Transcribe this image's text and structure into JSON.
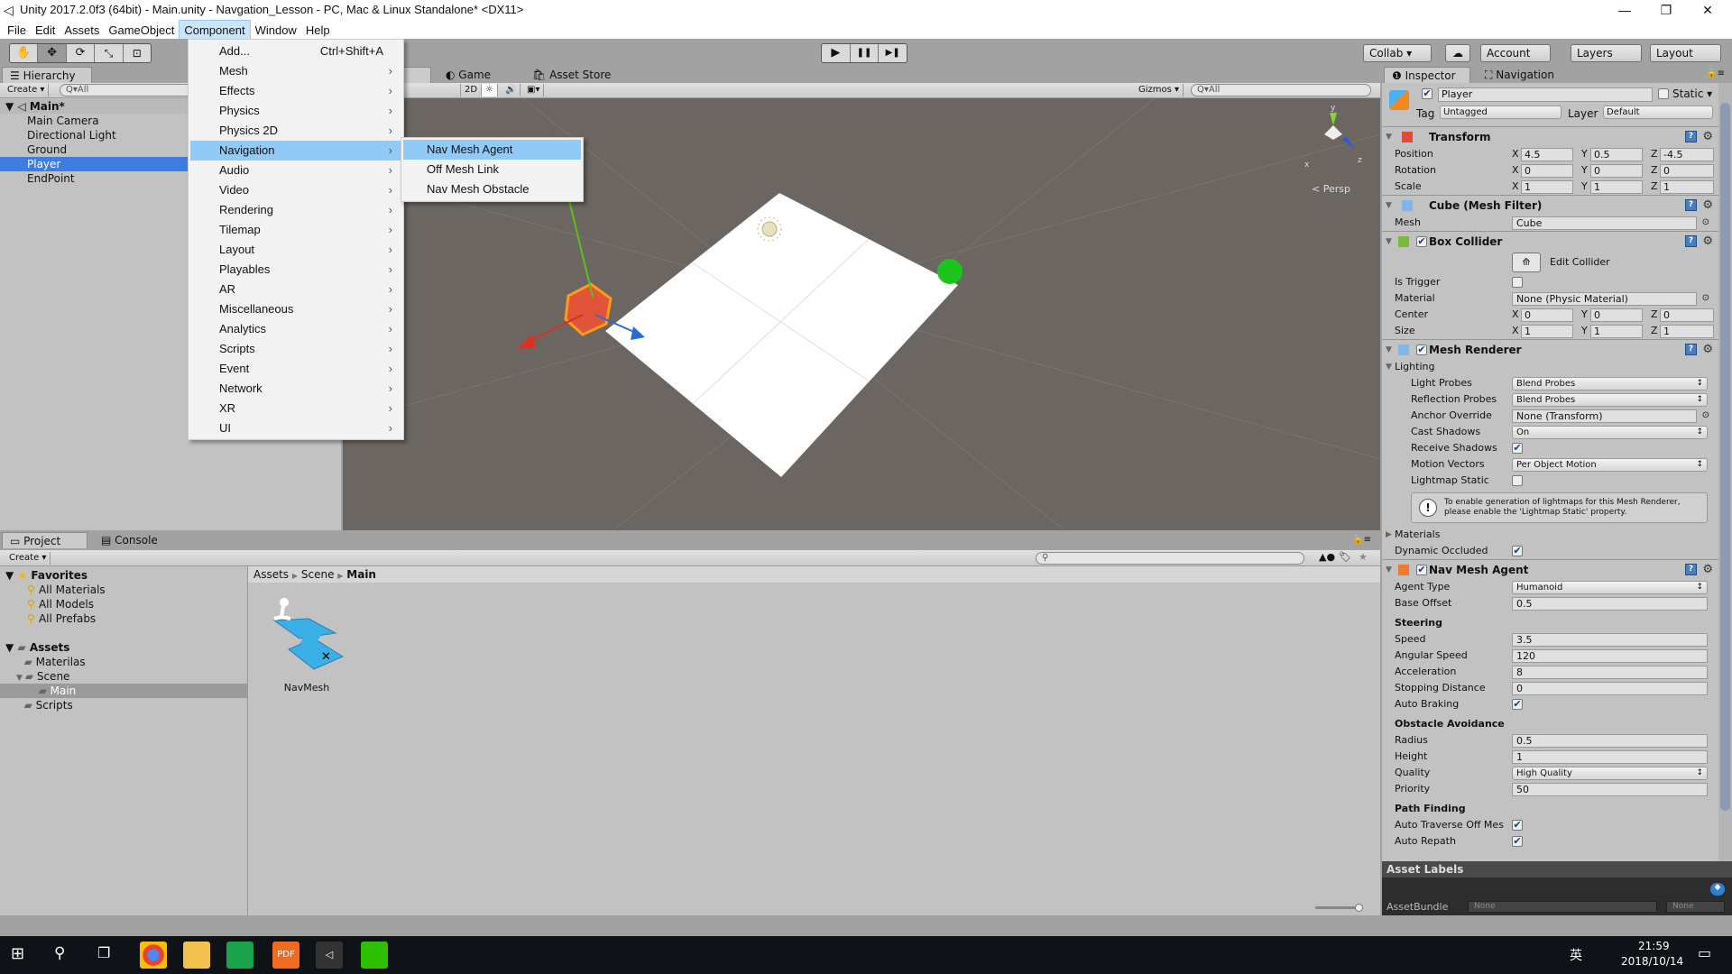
{
  "window": {
    "title": "Unity 2017.2.0f3 (64bit) - Main.unity - Navgation_Lesson - PC, Mac & Linux Standalone* <DX11>",
    "minimize": "—",
    "maximize": "❐",
    "close": "✕"
  },
  "menubar": [
    "File",
    "Edit",
    "Assets",
    "GameObject",
    "Component",
    "Window",
    "Help"
  ],
  "toolbar": {
    "tools": [
      "hand-tool",
      "move-tool",
      "rotate-tool",
      "scale-tool",
      "rect-tool"
    ],
    "play": "▶",
    "pause": "❚❚",
    "step": "▶❚",
    "collab": "Collab ▾",
    "cloud": "☁",
    "account": "Account",
    "layers": "Layers",
    "layout": "Layout"
  },
  "component_menu": {
    "items": [
      {
        "label": "Add...",
        "shortcut": "Ctrl+Shift+A"
      },
      {
        "label": "Mesh"
      },
      {
        "label": "Effects"
      },
      {
        "label": "Physics"
      },
      {
        "label": "Physics 2D"
      },
      {
        "label": "Navigation",
        "highlighted": true
      },
      {
        "label": "Audio"
      },
      {
        "label": "Video"
      },
      {
        "label": "Rendering"
      },
      {
        "label": "Tilemap"
      },
      {
        "label": "Layout"
      },
      {
        "label": "Playables"
      },
      {
        "label": "AR"
      },
      {
        "label": "Miscellaneous"
      },
      {
        "label": "Analytics"
      },
      {
        "label": "Scripts"
      },
      {
        "label": "Event"
      },
      {
        "label": "Network"
      },
      {
        "label": "XR"
      },
      {
        "label": "UI"
      }
    ],
    "submenu": [
      {
        "label": "Nav Mesh Agent",
        "highlighted": true
      },
      {
        "label": "Off Mesh Link"
      },
      {
        "label": "Nav Mesh Obstacle"
      }
    ]
  },
  "hierarchy": {
    "tab": "Hierarchy",
    "create": "Create ▾",
    "search": "Q▾All",
    "scene": "Main*",
    "items": [
      {
        "label": "Main Camera"
      },
      {
        "label": "Directional Light"
      },
      {
        "label": "Ground"
      },
      {
        "label": "Player",
        "selected": true
      },
      {
        "label": "EndPoint"
      }
    ]
  },
  "scene_view": {
    "tabs": [
      "Game",
      "Asset Store"
    ],
    "toggle_2d": "2D",
    "gizmos": "Gizmos ▾",
    "search": "Q▾All",
    "persp": "< Persp",
    "axis_x": "x",
    "axis_y": "y",
    "axis_z": "z"
  },
  "inspector": {
    "tabs": [
      "Inspector",
      "Navigation"
    ],
    "object": {
      "name": "Player",
      "active": true,
      "static_label": "Static",
      "tag_label": "Tag",
      "tag": "Untagged",
      "layer_label": "Layer",
      "layer": "Default"
    },
    "rows": [
      {
        "type": "comp",
        "title": "Transform",
        "icon": "transform"
      },
      {
        "type": "vec",
        "label": "Position",
        "x": "4.5",
        "y": "0.5",
        "z": "-4.5"
      },
      {
        "type": "vec",
        "label": "Rotation",
        "x": "0",
        "y": "0",
        "z": "0"
      },
      {
        "type": "vec",
        "label": "Scale",
        "x": "1",
        "y": "1",
        "z": "1"
      },
      {
        "type": "comp",
        "title": "Cube (Mesh Filter)",
        "icon": "mesh-filter"
      },
      {
        "type": "obj",
        "label": "Mesh",
        "value": "Cube"
      },
      {
        "type": "comp",
        "title": "Box Collider",
        "icon": "box-collider",
        "enabled": true
      },
      {
        "type": "button",
        "label": "Edit Collider"
      },
      {
        "type": "check",
        "label": "Is Trigger",
        "checked": false
      },
      {
        "type": "obj",
        "label": "Material",
        "value": "None (Physic Material)"
      },
      {
        "type": "vec",
        "label": "Center",
        "x": "0",
        "y": "0",
        "z": "0"
      },
      {
        "type": "vec",
        "label": "Size",
        "x": "1",
        "y": "1",
        "z": "1"
      },
      {
        "type": "comp",
        "title": "Mesh Renderer",
        "icon": "mesh-renderer",
        "enabled": true
      },
      {
        "type": "fold",
        "label": "Lighting"
      },
      {
        "type": "dd",
        "label": "Light Probes",
        "value": "Blend Probes",
        "indent": true
      },
      {
        "type": "dd",
        "label": "Reflection Probes",
        "value": "Blend Probes",
        "indent": true
      },
      {
        "type": "obj",
        "label": "Anchor Override",
        "value": "None (Transform)",
        "indent": true
      },
      {
        "type": "dd",
        "label": "Cast Shadows",
        "value": "On",
        "indent": true
      },
      {
        "type": "check",
        "label": "Receive Shadows",
        "checked": true,
        "indent": true
      },
      {
        "type": "dd",
        "label": "Motion Vectors",
        "value": "Per Object Motion",
        "indent": true
      },
      {
        "type": "check",
        "label": "Lightmap Static",
        "checked": false,
        "indent": true
      },
      {
        "type": "note",
        "text": "To enable generation of lightmaps for this Mesh Renderer, please enable the 'Lightmap Static' property."
      },
      {
        "type": "foldc",
        "label": "Materials"
      },
      {
        "type": "check",
        "label": "Dynamic Occluded",
        "checked": true
      },
      {
        "type": "comp",
        "title": "Nav Mesh Agent",
        "icon": "nav-mesh-agent",
        "enabled": true
      },
      {
        "type": "dd",
        "label": "Agent Type",
        "value": "Humanoid"
      },
      {
        "type": "field",
        "label": "Base Offset",
        "value": "0.5"
      },
      {
        "type": "sect",
        "label": "Steering"
      },
      {
        "type": "field",
        "label": "Speed",
        "value": "3.5"
      },
      {
        "type": "field",
        "label": "Angular Speed",
        "value": "120"
      },
      {
        "type": "field",
        "label": "Acceleration",
        "value": "8"
      },
      {
        "type": "field",
        "label": "Stopping Distance",
        "value": "0"
      },
      {
        "type": "check",
        "label": "Auto Braking",
        "checked": true
      },
      {
        "type": "sect",
        "label": "Obstacle Avoidance"
      },
      {
        "type": "field",
        "label": "Radius",
        "value": "0.5"
      },
      {
        "type": "field",
        "label": "Height",
        "value": "1"
      },
      {
        "type": "dd",
        "label": "Quality",
        "value": "High Quality"
      },
      {
        "type": "field",
        "label": "Priority",
        "value": "50"
      },
      {
        "type": "sect",
        "label": "Path Finding"
      },
      {
        "type": "check",
        "label": "Auto Traverse Off Mes",
        "checked": true
      },
      {
        "type": "check",
        "label": "Auto Repath",
        "checked": true
      }
    ],
    "asset_labels": {
      "title": "Asset Labels",
      "bundle_label": "AssetBundle",
      "bundle": "None",
      "variant": "None"
    }
  },
  "project": {
    "tabs": [
      "Project",
      "Console"
    ],
    "create": "Create ▾",
    "favorites": {
      "label": "Favorites",
      "items": [
        "All Materials",
        "All Models",
        "All Prefabs"
      ]
    },
    "assets": {
      "label": "Assets",
      "items": [
        {
          "label": "Materilas",
          "level": 1
        },
        {
          "label": "Scene",
          "level": 1,
          "expanded": true
        },
        {
          "label": "Main",
          "level": 2,
          "selected": true
        },
        {
          "label": "Scripts",
          "level": 1
        }
      ]
    },
    "breadcrumb": [
      "Assets",
      "Scene",
      "Main"
    ],
    "files": [
      {
        "label": "NavMesh"
      }
    ]
  },
  "taskbar": {
    "time": "21:59",
    "date": "2018/10/14",
    "ime": "英"
  },
  "colors": {
    "selection": "#3e7de0",
    "menu_highlight": "#91c9f7",
    "scene_bg": "#6b6661",
    "plane": "#ffffff"
  }
}
